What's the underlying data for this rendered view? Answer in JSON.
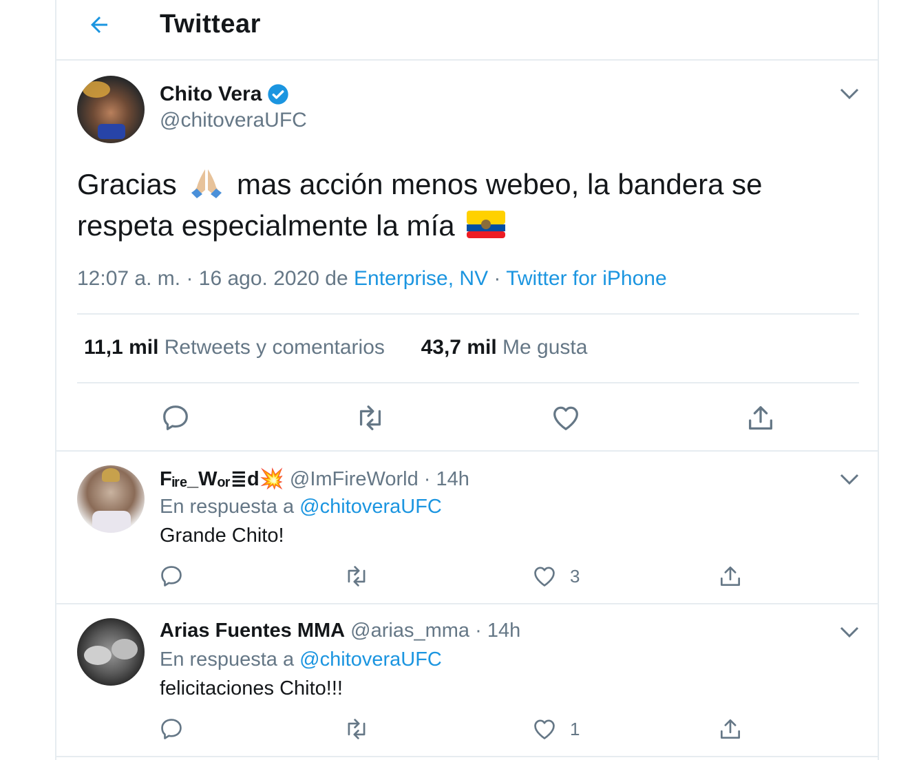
{
  "header": {
    "title": "Twittear",
    "back_icon": "arrow-left-icon"
  },
  "main_tweet": {
    "author_name": "Chito Vera",
    "author_handle": "@chitoveraUFC",
    "verified": true,
    "text_part1": "Gracias",
    "text_part2": "mas acción menos webeo, la bandera se respeta especialmente la mía",
    "time": "12:07 a. m.",
    "date": "16 ago. 2020",
    "location_prefix": "de",
    "location": "Enterprise, NV",
    "source": "Twitter for iPhone",
    "retweets_count": "11,1 mil",
    "retweets_label": "Retweets y comentarios",
    "likes_count": "43,7 mil",
    "likes_label": "Me gusta"
  },
  "replies": [
    {
      "author_name": "Fᵢᵣₑ_Wₒᵣ≣d💥",
      "author_handle": "@ImFireWorld",
      "time": "14h",
      "reply_to_label": "En respuesta a",
      "reply_to_handle": "@chitoveraUFC",
      "text": "Grande Chito!",
      "like_count": "3"
    },
    {
      "author_name": "Arias Fuentes MMA",
      "author_handle": "@arias_mma",
      "time": "14h",
      "reply_to_label": "En respuesta a",
      "reply_to_handle": "@chitoveraUFC",
      "text": "felicitaciones Chito!!!",
      "like_count": "1"
    }
  ],
  "colors": {
    "accent": "#1b95e0",
    "secondary_text": "#657786",
    "divider": "#e6ecf0",
    "icon": "#657786"
  }
}
